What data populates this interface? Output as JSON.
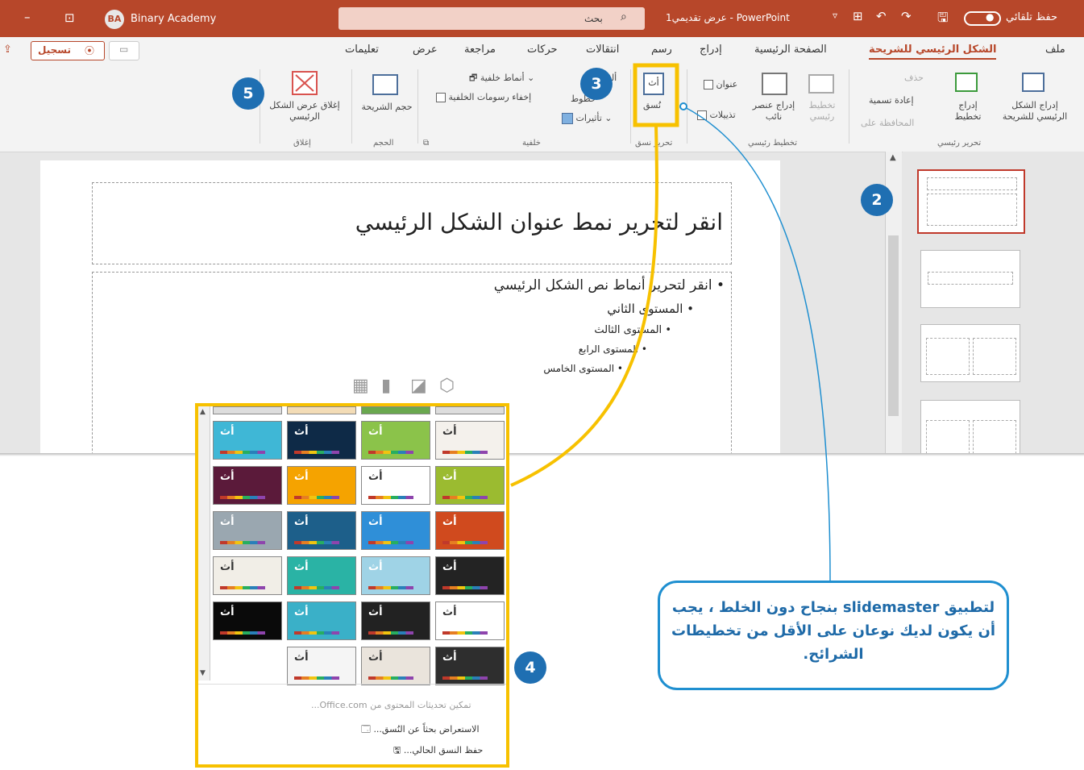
{
  "titlebar": {
    "autosave_label": "حفظ تلقائي",
    "toggle_state": "●",
    "doc_title": "عرض تقديمي1 - PowerPoint",
    "search_placeholder": "بحث",
    "user_initials": "BA",
    "user_name": "Binary Academy",
    "minimize_glyph": "–"
  },
  "menu": {
    "tabs": [
      "ملف",
      "الشكل الرئيسي للشريحة",
      "الصفحة الرئيسية",
      "إدراج",
      "رسم",
      "انتقالات",
      "حركات",
      "مراجعة",
      "عرض",
      "تعليمات"
    ],
    "record_label": "تسجيل"
  },
  "ribbon": {
    "insert_master": "إدراج الشكل الرئيسي للشريحة",
    "insert_layout": "إدراج تخطيط",
    "delete": "حذف",
    "rename": "إعادة تسمية",
    "preserve": "المحافظة على",
    "group_edit_master": "تحرير رئيسي",
    "master_layout": "تخطيط رئيسي",
    "insert_placeholder": "إدراج عنصر نائب",
    "title_check": "عنوان",
    "footers_check": "تذييلات",
    "group_master_layout": "تخطيط رئيسي",
    "themes": "نُسق",
    "group_edit_theme": "تحرير نسق",
    "colors": "ألوان",
    "fonts": "خطوط",
    "effects": "تأثيرات",
    "background_styles": "أنماط خلفية",
    "hide_background_graphics": "إخفاء رسومات الخلفية",
    "group_background": "خلفية",
    "slide_size": "حجم الشريحة",
    "group_size": "الحجم",
    "close_master_view": "إغلاق عرض الشكل الرئيسي",
    "group_close": "إغلاق"
  },
  "slide": {
    "title_placeholder": "انقر لتحرير نمط عنوان الشكل الرئيسي",
    "levels": [
      "انقر لتحرير أنماط نص الشكل الرئيسي",
      "المستوى الثاني",
      "المستوى الثالث",
      "المستوى الرابع",
      "المستوى الخامس"
    ]
  },
  "gallery": {
    "theme_glyph": "أث",
    "enable_updates": "تمكين تحديثات المحتوى من Office.com...",
    "browse_themes": "الاستعراض بحثاً عن النُسق...",
    "save_theme": "حفظ النسق الحالي..."
  },
  "callout": {
    "text": "لتطبيق slidemaster بنجاح دون الخلط ، يجب أن يكون لديك نوعان على الأقل من تخطيطات الشرائح."
  },
  "badges": {
    "b2": "2",
    "b3": "3",
    "b4": "4",
    "b5": "5"
  },
  "colors": {
    "accent_red": "#b7472a",
    "highlight_yellow": "#f7c100",
    "callout_blue": "#1f8fd0",
    "badge_blue": "#1f6fb2"
  }
}
